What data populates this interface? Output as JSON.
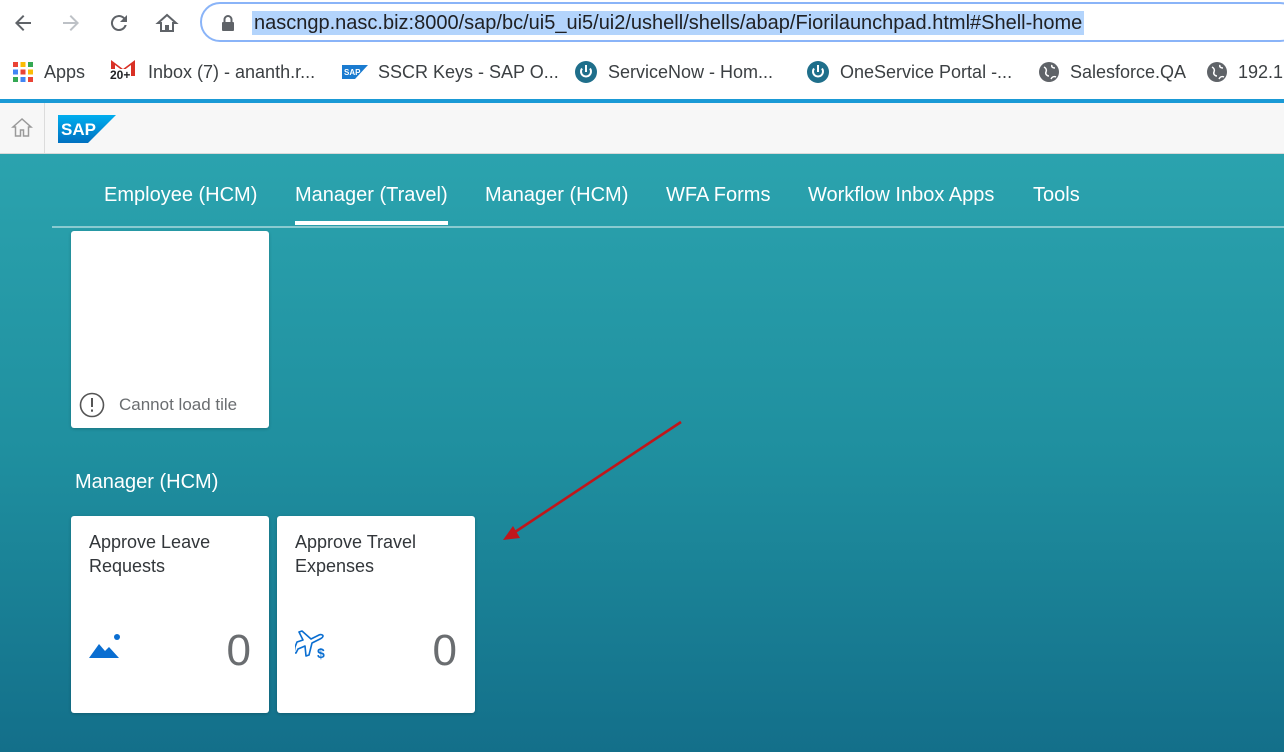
{
  "browser": {
    "url": "nascngp.nasc.biz:8000/sap/bc/ui5_ui5/ui2/ushell/shells/abap/Fiorilaunchpad.html#Shell-home",
    "bookmarks": [
      {
        "label": "Apps",
        "icon": "apps-grid-icon"
      },
      {
        "label": "Inbox (7) - ananth.r...",
        "icon": "gmail-icon",
        "badge": "20+"
      },
      {
        "label": "SSCR Keys - SAP O...",
        "icon": "sap-small-icon"
      },
      {
        "label": "ServiceNow - Hom...",
        "icon": "power-icon"
      },
      {
        "label": "OneService Portal -...",
        "icon": "power-icon"
      },
      {
        "label": "Salesforce.QA",
        "icon": "globe-icon"
      },
      {
        "label": "192.1",
        "icon": "globe-icon"
      }
    ]
  },
  "sap": {
    "logo": "SAP",
    "tabs": [
      {
        "label": "Employee (HCM)"
      },
      {
        "label": "Manager (Travel)",
        "active": true
      },
      {
        "label": "Manager (HCM)"
      },
      {
        "label": "WFA Forms"
      },
      {
        "label": "Workflow Inbox Apps"
      },
      {
        "label": "Tools"
      }
    ],
    "error_tile": {
      "text": "Cannot load tile"
    },
    "group": {
      "title": "Manager (HCM)",
      "tiles": [
        {
          "title": "Approve Leave Requests",
          "count": "0",
          "icon": "mountain-icon"
        },
        {
          "title": "Approve Travel Expenses",
          "count": "0",
          "icon": "travel-expense-icon"
        }
      ]
    }
  },
  "colors": {
    "accent": "#1a9ad6",
    "icon_blue": "#0a6ed1",
    "arrow": "#c0161b"
  }
}
